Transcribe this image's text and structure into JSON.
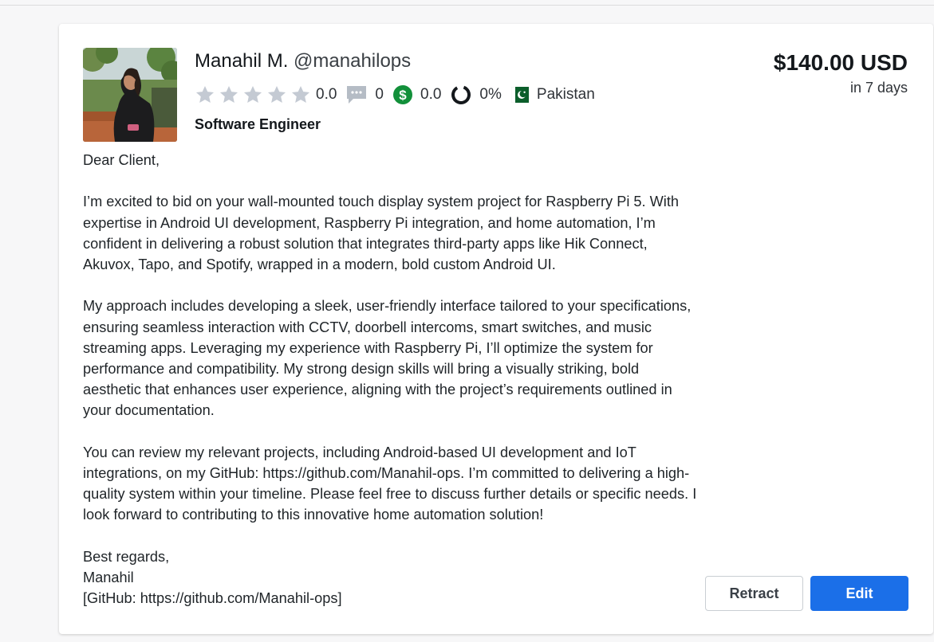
{
  "bid": {
    "freelancer": {
      "name": "Manahil M.",
      "handle": "@manahilops",
      "title": "Software Engineer",
      "rating": "0.0",
      "rating_stars": 0,
      "reviews": "0",
      "earnings_score": "0.0",
      "completion": "0%",
      "country": "Pakistan"
    },
    "price": {
      "amount": "$140.00 USD",
      "duration": "in 7 days"
    },
    "proposal": {
      "greeting": "Dear Client,",
      "paragraphs": [
        "I’m excited to bid on your wall-mounted touch display system project for Raspberry Pi 5. With expertise in Android UI development, Raspberry Pi integration, and home automation, I’m confident in delivering a robust solution that integrates third-party apps like Hik Connect, Akuvox, Tapo, and Spotify, wrapped in a modern, bold custom Android UI.",
        "My approach includes developing a sleek, user-friendly interface tailored to your specifications, ensuring seamless interaction with CCTV, doorbell intercoms, smart switches, and music streaming apps. Leveraging my experience with Raspberry Pi, I’ll optimize the system for performance and compatibility. My strong design skills will bring a visually striking, bold aesthetic that enhances user experience, aligning with the project’s requirements outlined in your documentation.",
        "You can review my relevant projects, including Android-based UI development and IoT integrations, on my GitHub: https://github.com/Manahil-ops. I’m committed to delivering a high-quality system within your timeline. Please feel free to discuss further details or specific needs. I look forward to contributing to this innovative home automation solution!"
      ],
      "closing": "Best regards,",
      "signature": "Manahil",
      "github_line": "[GitHub: https://github.com/Manahil-ops]"
    },
    "actions": {
      "retract_label": "Retract",
      "edit_label": "Edit"
    }
  },
  "icons": {
    "stars": "star-icon",
    "reviews": "comment-icon",
    "earnings": "dollar-circle-icon",
    "completion": "ring-progress-icon",
    "flag": "pakistan-flag-icon"
  },
  "colors": {
    "primary": "#1b6fe8",
    "star_empty": "#c4cad3",
    "earnings_green": "#12903a",
    "flag_green": "#0b5e2b"
  }
}
